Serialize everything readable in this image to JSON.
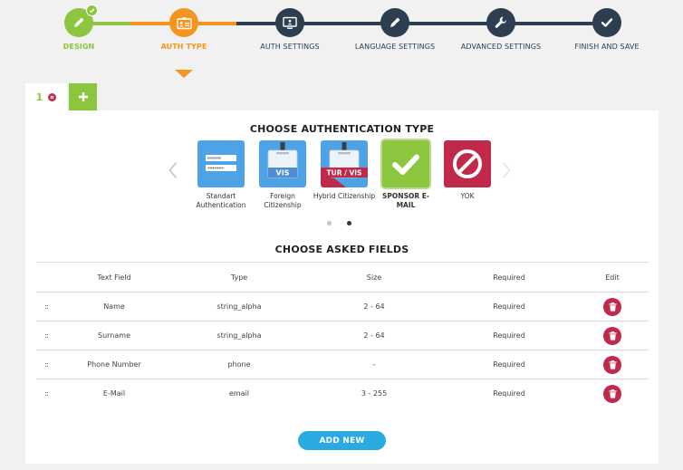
{
  "wizard": {
    "steps": [
      {
        "label": "DESIGN",
        "state": "done",
        "icon": "pencil-icon"
      },
      {
        "label": "AUTH TYPE",
        "state": "active",
        "icon": "id-card-icon"
      },
      {
        "label": "AUTH SETTINGS",
        "state": "todo",
        "icon": "monitor-icon"
      },
      {
        "label": "LANGUAGE SETTINGS",
        "state": "todo",
        "icon": "pencil-icon"
      },
      {
        "label": "ADVANCED SETTINGS",
        "state": "todo",
        "icon": "wrench-icon"
      },
      {
        "label": "FINISH AND SAVE",
        "state": "todo",
        "icon": "check-icon"
      }
    ],
    "colors": {
      "done": "#8cc63f",
      "active": "#f7941d",
      "todo": "#2c3e50"
    }
  },
  "tabs": {
    "items": [
      {
        "number": "1"
      }
    ],
    "add_label": "+"
  },
  "auth_section": {
    "title": "CHOOSE AUTHENTICATION TYPE",
    "options": [
      {
        "label": "Standart Authentication",
        "icon": "login-form-icon",
        "tile_color": "#4da3e6",
        "selected": false
      },
      {
        "label": "Foreign Citizenship",
        "icon": "badge-vis-icon",
        "tile_color": "#4da3e6",
        "badge_text": "VIS",
        "selected": false
      },
      {
        "label": "Hybrid Citizenship",
        "icon": "badge-tur-vis-icon",
        "tile_color": "#4da3e6",
        "badge_text": "TUR / VIS",
        "selected": false
      },
      {
        "label": "SPONSOR E-MAIL",
        "icon": "check-icon",
        "tile_color": "#8cc63f",
        "selected": true
      },
      {
        "label": "YOK",
        "icon": "prohibited-icon",
        "tile_color": "#c0294a",
        "selected": false
      }
    ],
    "pages": 2,
    "active_page": 2
  },
  "fields_section": {
    "title": "CHOOSE ASKED FIELDS",
    "columns": [
      "Text Field",
      "Type",
      "Size",
      "Required",
      "Edit"
    ],
    "rows": [
      {
        "handle": "::",
        "text_field": "Name",
        "type": "string_alpha",
        "size": "2 - 64",
        "required": "Required"
      },
      {
        "handle": "::",
        "text_field": "Surname",
        "type": "string_alpha",
        "size": "2 - 64",
        "required": "Required"
      },
      {
        "handle": "::",
        "text_field": "Phone Number",
        "type": "phone",
        "size": "-",
        "required": "Required"
      },
      {
        "handle": "::",
        "text_field": "E-Mail",
        "type": "email",
        "size": "3 - 255",
        "required": "Required"
      }
    ],
    "add_button": "ADD NEW"
  }
}
